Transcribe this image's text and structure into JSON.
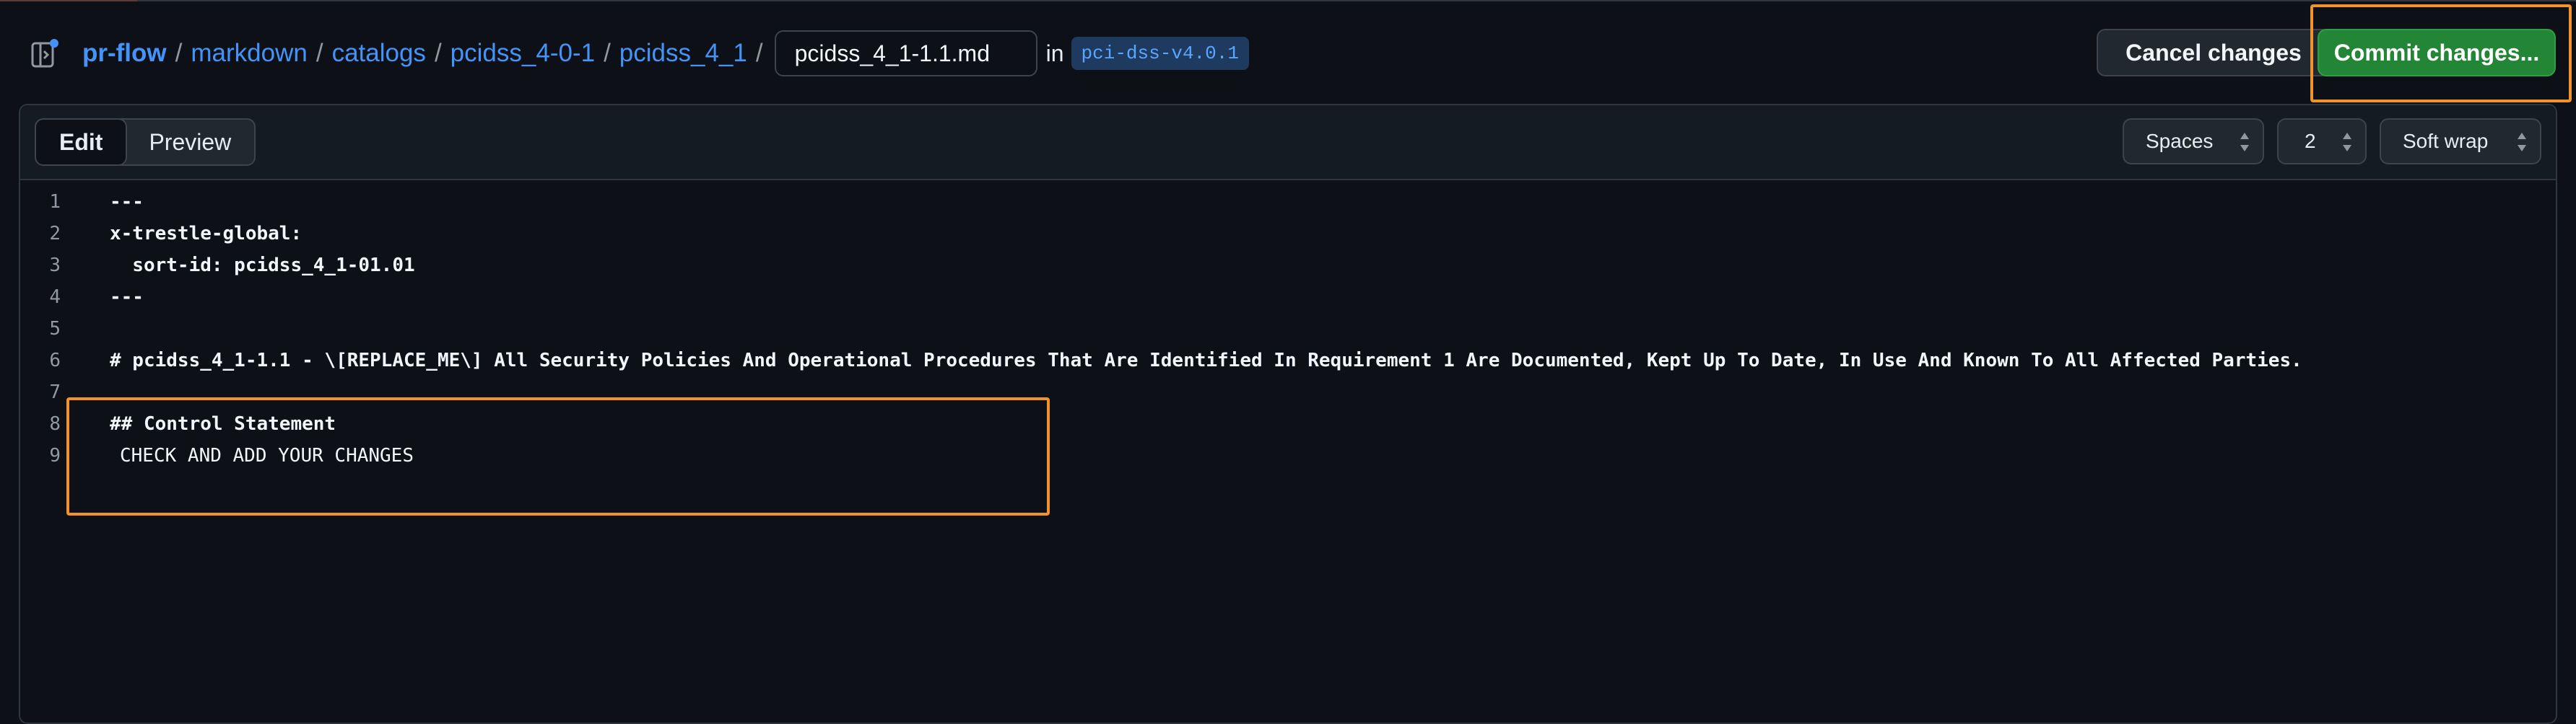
{
  "breadcrumb": {
    "repo": "pr-flow",
    "folders": [
      "markdown",
      "catalogs",
      "pcidss_4-0-1",
      "pcidss_4_1"
    ],
    "separator": "/"
  },
  "filename": {
    "value": "pcidss_4_1-1.1.md"
  },
  "branch": {
    "in_label": "in",
    "name": "pci-dss-v4.0.1"
  },
  "actions": {
    "cancel_label": "Cancel changes",
    "commit_label": "Commit changes..."
  },
  "editor": {
    "tabs": [
      {
        "label": "Edit",
        "active": true
      },
      {
        "label": "Preview",
        "active": false
      }
    ],
    "indent_mode": "Spaces",
    "indent_size": "2",
    "wrap_mode": "Soft wrap"
  },
  "code_lines": [
    {
      "num": "1",
      "text": "---"
    },
    {
      "num": "2",
      "text": "x-trestle-global:"
    },
    {
      "num": "3",
      "text": "  sort-id: pcidss_4_1-01.01"
    },
    {
      "num": "4",
      "text": "---"
    },
    {
      "num": "5",
      "text": ""
    },
    {
      "num": "6",
      "text": "# pcidss_4_1-1.1 - \\[REPLACE_ME\\] All Security Policies And Operational Procedures That Are Identified In Requirement 1 Are Documented, Kept Up To Date, In Use And Known To All Affected Parties."
    },
    {
      "num": "7",
      "text": ""
    },
    {
      "num": "8",
      "text": "## Control Statement"
    },
    {
      "num": "9",
      "text": "CHECK AND ADD YOUR CHANGES"
    }
  ],
  "colors": {
    "background": "#0d1117",
    "link": "#4493f8",
    "commit_button": "#238636",
    "highlight_box": "#f0932b"
  },
  "icons": {
    "sidebar_toggle": "sidebar-expand-icon",
    "select_arrows": "chevron-up-down-icon"
  }
}
